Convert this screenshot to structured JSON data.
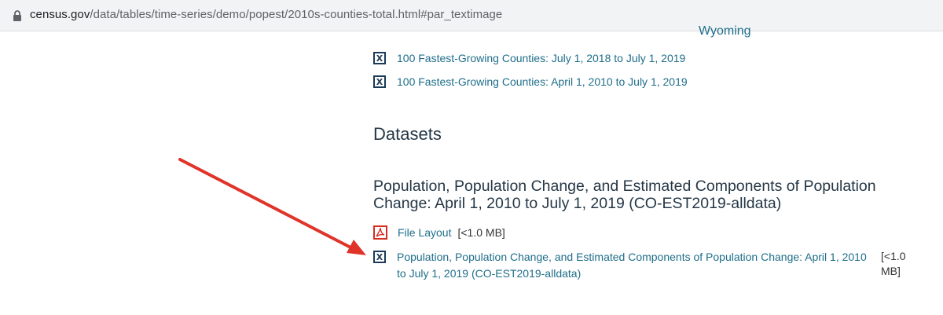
{
  "browser": {
    "url_domain": "census.gov",
    "url_path": "/data/tables/time-series/demo/popest/2010s-counties-total.html#par_textimage"
  },
  "top": {
    "partial_link": "Wyoming",
    "links": [
      "100 Fastest-Growing Counties: July 1, 2018 to July 1, 2019",
      "100 Fastest-Growing Counties: April 1, 2010 to July 1, 2019"
    ]
  },
  "datasets": {
    "heading": "Datasets",
    "dataset_title": "Population, Population Change, and Estimated Components of Population Change: April 1, 2010 to July 1, 2019 (CO-EST2019-alldata)",
    "file_layout": {
      "label": "File Layout",
      "size": "[<1.0 MB]"
    },
    "data_file": {
      "label": "Population, Population Change, and Estimated Components of Population Change: April 1, 2010 to July 1, 2019 (CO-EST2019-alldata)",
      "size": "[<1.0 MB]"
    }
  },
  "colors": {
    "link": "#1f6e8a",
    "heading": "#253746",
    "xls_icon": "#1b3a57",
    "pdf_icon": "#d62d20",
    "annotation_arrow": "#e0342a"
  },
  "icons": {
    "lock": "lock-icon",
    "xls": "xls-icon",
    "pdf": "pdf-icon",
    "arrow": "annotation-arrow"
  }
}
